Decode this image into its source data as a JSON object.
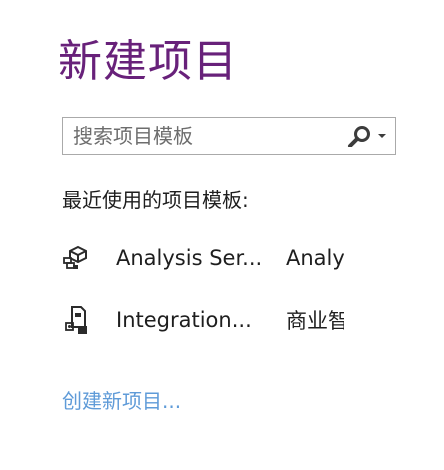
{
  "page": {
    "title": "新建项目",
    "section_label": "最近使用的项目模板:",
    "create_link": "创建新项目..."
  },
  "search": {
    "placeholder": "搜索项目模板",
    "value": "",
    "icon": "search-icon",
    "dropdown_icon": "caret-down-icon"
  },
  "templates": [
    {
      "name": "Analysis Ser...",
      "category": "Analy",
      "icon": "analysis-services-icon"
    },
    {
      "name": "Integration...",
      "category": "商业智",
      "icon": "integration-services-icon"
    }
  ],
  "colors": {
    "title": "#68217a",
    "link": "#5f9bd8",
    "text": "#1e1e1e",
    "border": "#aaaaaa"
  }
}
